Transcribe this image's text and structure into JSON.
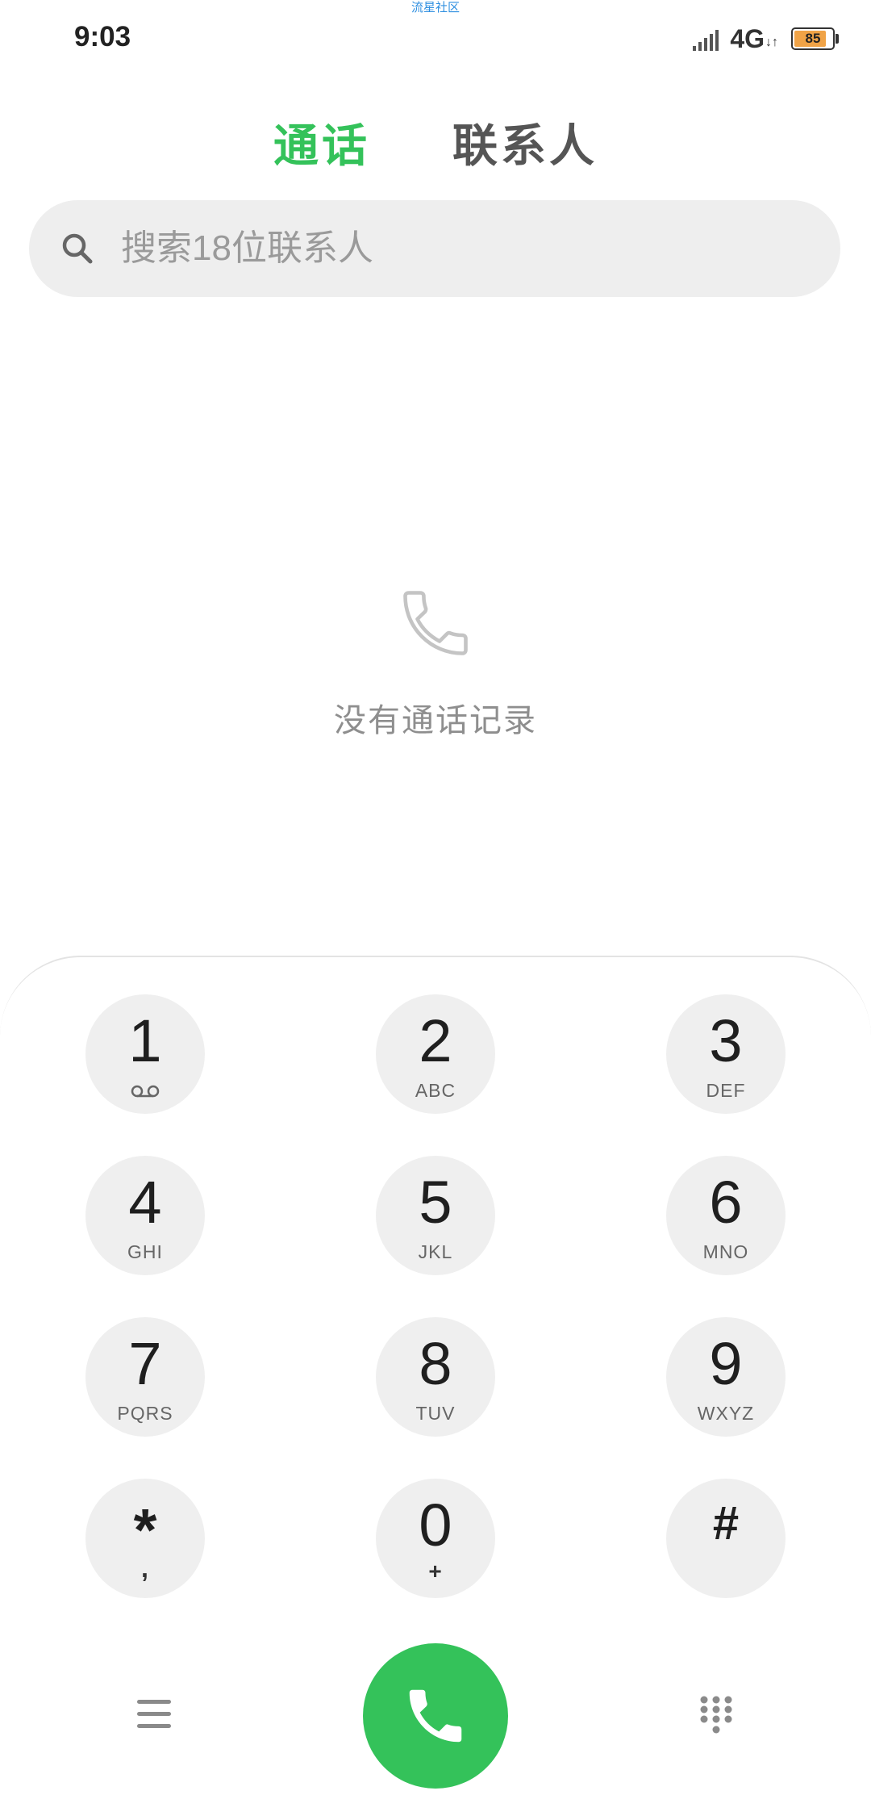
{
  "watermark": "流星社区",
  "status": {
    "time": "9:03",
    "network": "4G",
    "network_arrows": "↓↑",
    "battery": "85",
    "battery_color": "#f0a347"
  },
  "tabs": [
    {
      "label": "通话",
      "active": true
    },
    {
      "label": "联系人",
      "active": false
    }
  ],
  "search": {
    "placeholder": "搜索18位联系人",
    "icon": "search-icon"
  },
  "empty_state": {
    "icon": "phone-outline-icon",
    "text": "没有通话记录"
  },
  "keypad": [
    {
      "digit": "1",
      "letters": "",
      "sub_icon": "voicemail-icon"
    },
    {
      "digit": "2",
      "letters": "ABC"
    },
    {
      "digit": "3",
      "letters": "DEF"
    },
    {
      "digit": "4",
      "letters": "GHI"
    },
    {
      "digit": "5",
      "letters": "JKL"
    },
    {
      "digit": "6",
      "letters": "MNO"
    },
    {
      "digit": "7",
      "letters": "PQRS"
    },
    {
      "digit": "8",
      "letters": "TUV"
    },
    {
      "digit": "9",
      "letters": "WXYZ"
    },
    {
      "digit": "*",
      "letters": ","
    },
    {
      "digit": "0",
      "letters": "+"
    },
    {
      "digit": "#",
      "letters": ""
    }
  ],
  "bottom_bar": {
    "menu_icon": "menu-icon",
    "call_icon": "phone-call-icon",
    "dialpad_icon": "dialpad-icon",
    "accent": "#34c25a"
  }
}
